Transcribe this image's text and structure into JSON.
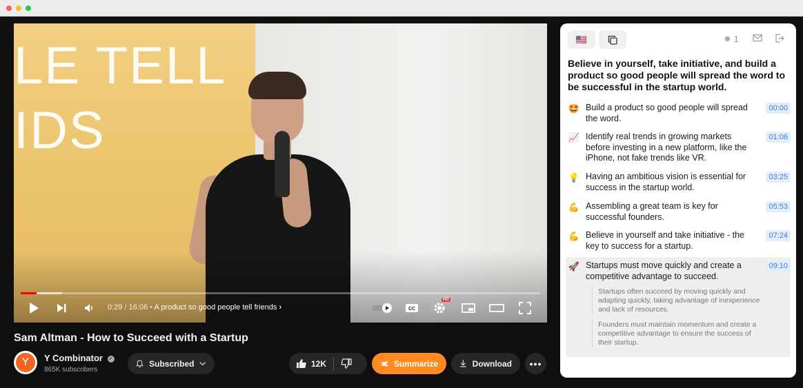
{
  "video": {
    "slide_lines": [
      "LE TELL",
      "IDS"
    ],
    "progress_fraction": 0.03,
    "time_current": "0:29",
    "time_total": "16:06",
    "separator": "/",
    "bullet": "•",
    "chapter": "A product so good people tell friends",
    "hd_badge": "HD"
  },
  "title": "Sam Altman - How to Succeed with a Startup",
  "channel": {
    "name": "Y Combinator",
    "subscribers": "865K subscribers",
    "avatar_letter": "Y"
  },
  "actions": {
    "subscribed_label": "Subscribed",
    "like_count": "12K",
    "summarize_label": "Summarize",
    "download_label": "Download"
  },
  "panel": {
    "flag_icon": "🇺🇸",
    "spark_count": "1",
    "headline": "Believe in yourself, take initiative, and build a product so good people will spread the word to be successful in the startup world.",
    "items": [
      {
        "emoji": "🤩",
        "text": "Build a product so good people will spread the word.",
        "ts": "00:00"
      },
      {
        "emoji": "📈",
        "text": "Identify real trends in growing markets before investing in a new platform, like the iPhone, not fake trends like VR.",
        "ts": "01:06"
      },
      {
        "emoji": "💡",
        "text": "Having an ambitious vision is essential for success in the startup world.",
        "ts": "03:25"
      },
      {
        "emoji": "💪",
        "text": "Assembling a great team is key for successful founders.",
        "ts": "05:53"
      },
      {
        "emoji": "💪",
        "text": "Believe in yourself and take initiative - the key to success for a startup.",
        "ts": "07:24"
      },
      {
        "emoji": "🚀",
        "text": "Startups must move quickly and create a competitive advantage to succeed.",
        "ts": "09:10"
      }
    ],
    "subnotes": [
      "Startups often succeed by moving quickly and adapting quickly, taking advantage of inexperience and lack of resources.",
      "Founders must maintain momentum and create a competitive advantage to ensure the success of their startup."
    ]
  },
  "colors": {
    "progress": "#ff0000",
    "summarize": "#ff8a1f",
    "timestamp": "#3d7bd8"
  }
}
